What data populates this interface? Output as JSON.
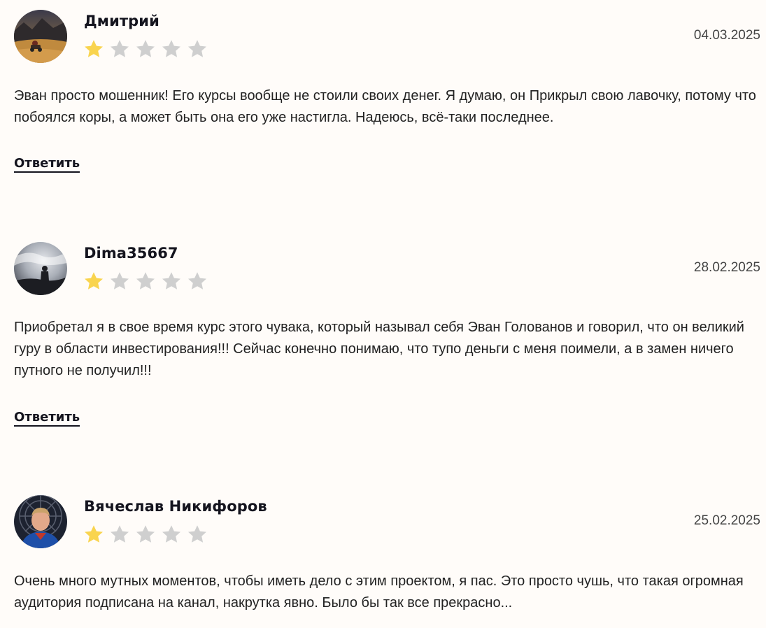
{
  "reviews": [
    {
      "author": "Дмитрий",
      "date": "04.03.2025",
      "rating": 1,
      "rating_max": 5,
      "text": "Эван просто мошенник! Его курсы вообще не стоили своих денег. Я думаю, он Прикрыл свою лавочку, потому что побоялся коры, а может быть она его уже настигла. Надеюсь, всё-таки последнее.",
      "reply_label": "Ответить"
    },
    {
      "author": "Dima35667",
      "date": "28.02.2025",
      "rating": 1,
      "rating_max": 5,
      "text": "Приобретал я в свое время курс этого чувака, который называл себя Эван Голованов и говорил, что он великий гуру в области инвестирования!!! Сейчас конечно понимаю, что тупо деньги с меня поимели, а в замен ничего путного не получил!!!",
      "reply_label": "Ответить"
    },
    {
      "author": "Вячеслав Никифоров",
      "date": "25.02.2025",
      "rating": 1,
      "rating_max": 5,
      "text": "Очень много мутных моментов, чтобы иметь дело с этим проектом, я пас. Это просто чушь, что такая огромная аудитория подписана на канал, накрутка явно. Было бы так все прекрасно..."
    }
  ],
  "colors": {
    "background": "#fffcf9",
    "star_filled": "#f9d44e",
    "star_empty": "#cfcfcf",
    "author_text": "#14141e",
    "body_text": "#222222",
    "date_text": "#444444"
  },
  "icons": {
    "star": "star-icon"
  }
}
